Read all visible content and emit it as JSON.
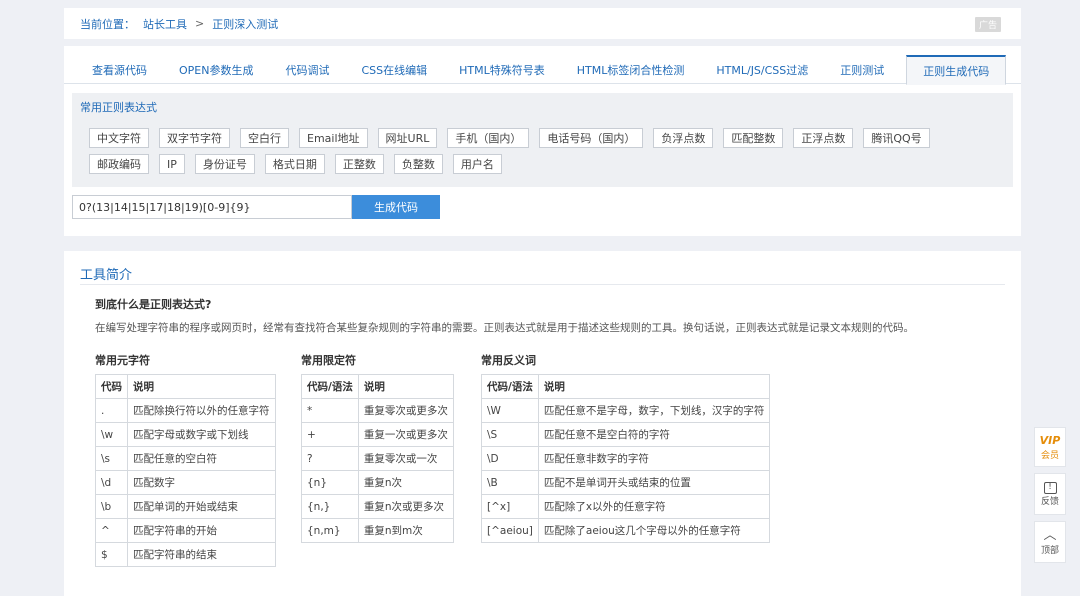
{
  "breadcrumb": {
    "label": "当前位置：",
    "crumb1": "站长工具",
    "sep": ">",
    "crumb2": "正则深入测试",
    "ad": "广告"
  },
  "tabs": [
    {
      "label": "查看源代码"
    },
    {
      "label": "OPEN参数生成"
    },
    {
      "label": "代码调试"
    },
    {
      "label": "CSS在线编辑"
    },
    {
      "label": "HTML特殊符号表"
    },
    {
      "label": "HTML标签闭合性检测"
    },
    {
      "label": "HTML/JS/CSS过滤"
    },
    {
      "label": "正则测试"
    },
    {
      "label": "正则生成代码",
      "active": true
    }
  ],
  "regex_panel": {
    "title": "常用正则表达式",
    "chips": [
      "中文字符",
      "双字节字符",
      "空白行",
      "Email地址",
      "网址URL",
      "手机（国内）",
      "电话号码（国内）",
      "负浮点数",
      "匹配整数",
      "正浮点数",
      "腾讯QQ号",
      "邮政编码",
      "IP",
      "身份证号",
      "格式日期",
      "正整数",
      "负整数",
      "用户名"
    ]
  },
  "input": {
    "value": "0?(13|14|15|17|18|19)[0-9]{9}",
    "button": "生成代码"
  },
  "intro": {
    "title": "工具简介",
    "question": "到底什么是正则表达式?",
    "description": "在编写处理字符串的程序或网页时，经常有查找符合某些复杂规则的字符串的需要。正则表达式就是用于描述这些规则的工具。换句话说，正则表达式就是记录文本规则的代码。"
  },
  "tables": [
    {
      "title": "常用元字符",
      "headers": [
        "代码",
        "说明"
      ],
      "rows": [
        [
          ".",
          "匹配除换行符以外的任意字符"
        ],
        [
          "\\w",
          "匹配字母或数字或下划线"
        ],
        [
          "\\s",
          "匹配任意的空白符"
        ],
        [
          "\\d",
          "匹配数字"
        ],
        [
          "\\b",
          "匹配单词的开始或结束"
        ],
        [
          "^",
          "匹配字符串的开始"
        ],
        [
          "$",
          "匹配字符串的结束"
        ]
      ]
    },
    {
      "title": "常用限定符",
      "headers": [
        "代码/语法",
        "说明"
      ],
      "rows": [
        [
          "*",
          "重复零次或更多次"
        ],
        [
          "+",
          "重复一次或更多次"
        ],
        [
          "?",
          "重复零次或一次"
        ],
        [
          "{n}",
          "重复n次"
        ],
        [
          "{n,}",
          "重复n次或更多次"
        ],
        [
          "{n,m}",
          "重复n到m次"
        ]
      ]
    },
    {
      "title": "常用反义词",
      "headers": [
        "代码/语法",
        "说明"
      ],
      "rows": [
        [
          "\\W",
          "匹配任意不是字母，数字，下划线，汉字的字符"
        ],
        [
          "\\S",
          "匹配任意不是空白符的字符"
        ],
        [
          "\\D",
          "匹配任意非数字的字符"
        ],
        [
          "\\B",
          "匹配不是单词开头或结束的位置"
        ],
        [
          "[^x]",
          "匹配除了x以外的任意字符"
        ],
        [
          "[^aeiou]",
          "匹配除了aeiou这几个字母以外的任意字符"
        ]
      ]
    }
  ],
  "sidebar": {
    "vip_icon": "VIP",
    "vip_label": "会员",
    "feedback_icon": "!",
    "feedback_label": "反馈",
    "top_icon": "︿",
    "top_label": "顶部"
  }
}
